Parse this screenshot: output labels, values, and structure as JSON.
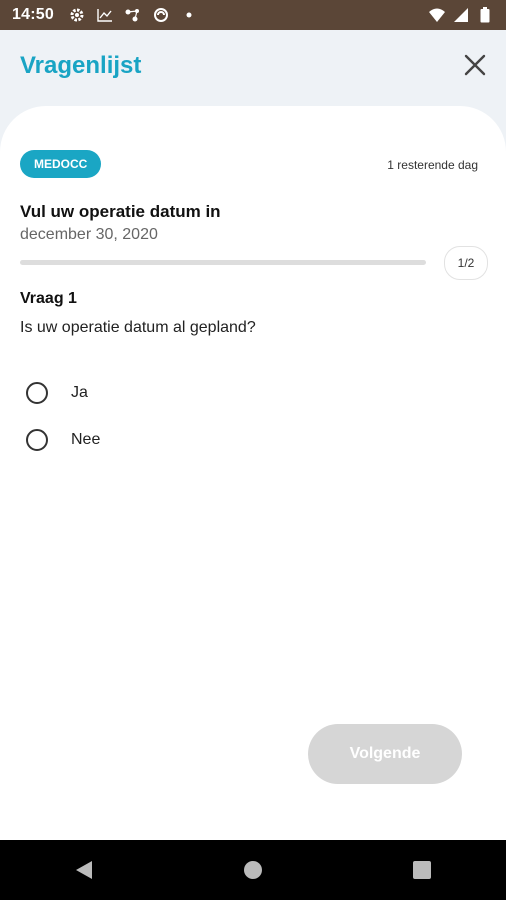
{
  "status_bar": {
    "time": "14:50",
    "left_icons": [
      "settings-icon",
      "chart-icon",
      "connection-icon",
      "sync-icon",
      "dot-icon"
    ],
    "right_icons": [
      "wifi-icon",
      "signal-icon",
      "battery-icon"
    ]
  },
  "header": {
    "title": "Vragenlijst"
  },
  "card": {
    "badge": "MEDOCC",
    "remaining": "1 resterende dag",
    "title": "Vul uw operatie datum in",
    "date": "december 30, 2020",
    "progress_fraction": 0,
    "step": "1/2",
    "question_label": "Vraag 1",
    "question_text": "Is uw operatie datum al gepland?",
    "options": [
      {
        "label": "Ja"
      },
      {
        "label": "Nee"
      }
    ],
    "next_label": "Volgende"
  },
  "nav": {
    "icons": [
      "back-icon",
      "home-icon",
      "recents-icon"
    ]
  },
  "colors": {
    "accent": "#1aa6c4",
    "status_bar": "#5b4637",
    "disabled": "#d6d6d6"
  }
}
